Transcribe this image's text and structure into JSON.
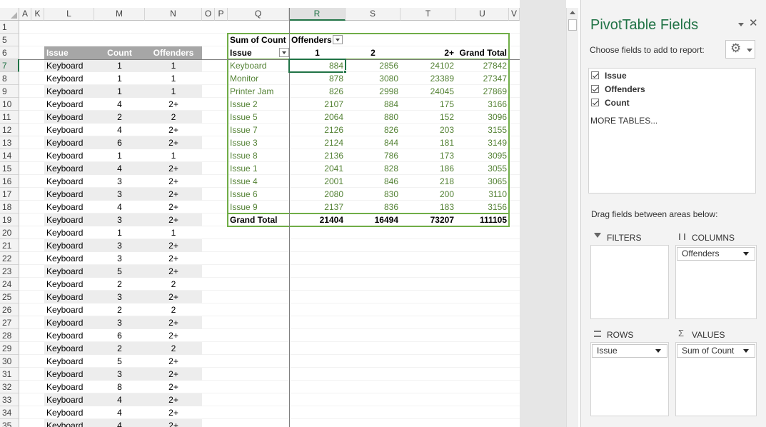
{
  "columns": [
    {
      "label": "A",
      "width": 17
    },
    {
      "label": "K",
      "width": 18
    },
    {
      "label": "L",
      "width": 70
    },
    {
      "label": "M",
      "width": 71
    },
    {
      "label": "N",
      "width": 80
    },
    {
      "label": "O",
      "width": 18
    },
    {
      "label": "P",
      "width": 18
    },
    {
      "label": "Q",
      "width": 86
    },
    {
      "label": "R",
      "width": 79
    },
    {
      "label": "S",
      "width": 77
    },
    {
      "label": "T",
      "width": 78
    },
    {
      "label": "U",
      "width": 74
    },
    {
      "label": "V",
      "width": 15
    }
  ],
  "selected_column": "R",
  "selected_row": "7",
  "row_numbers": [
    "1",
    "5",
    "6",
    "7",
    "8",
    "9",
    "10",
    "11",
    "12",
    "13",
    "14",
    "15",
    "16",
    "17",
    "18",
    "19",
    "20",
    "21",
    "22",
    "23",
    "24",
    "25",
    "26",
    "27",
    "28",
    "29",
    "30",
    "31",
    "32",
    "33",
    "34",
    "35"
  ],
  "table": {
    "headers": [
      "Issue",
      "Count",
      "Offenders"
    ],
    "rows": [
      [
        "Keyboard",
        "1",
        "1"
      ],
      [
        "Keyboard",
        "1",
        "1"
      ],
      [
        "Keyboard",
        "1",
        "1"
      ],
      [
        "Keyboard",
        "4",
        "2+"
      ],
      [
        "Keyboard",
        "2",
        "2"
      ],
      [
        "Keyboard",
        "4",
        "2+"
      ],
      [
        "Keyboard",
        "6",
        "2+"
      ],
      [
        "Keyboard",
        "1",
        "1"
      ],
      [
        "Keyboard",
        "4",
        "2+"
      ],
      [
        "Keyboard",
        "3",
        "2+"
      ],
      [
        "Keyboard",
        "3",
        "2+"
      ],
      [
        "Keyboard",
        "4",
        "2+"
      ],
      [
        "Keyboard",
        "3",
        "2+"
      ],
      [
        "Keyboard",
        "1",
        "1"
      ],
      [
        "Keyboard",
        "3",
        "2+"
      ],
      [
        "Keyboard",
        "3",
        "2+"
      ],
      [
        "Keyboard",
        "5",
        "2+"
      ],
      [
        "Keyboard",
        "2",
        "2"
      ],
      [
        "Keyboard",
        "3",
        "2+"
      ],
      [
        "Keyboard",
        "2",
        "2"
      ],
      [
        "Keyboard",
        "3",
        "2+"
      ],
      [
        "Keyboard",
        "6",
        "2+"
      ],
      [
        "Keyboard",
        "2",
        "2"
      ],
      [
        "Keyboard",
        "5",
        "2+"
      ],
      [
        "Keyboard",
        "3",
        "2+"
      ],
      [
        "Keyboard",
        "8",
        "2+"
      ],
      [
        "Keyboard",
        "4",
        "2+"
      ],
      [
        "Keyboard",
        "4",
        "2+"
      ],
      [
        "Keyboard",
        "4",
        "2+"
      ]
    ]
  },
  "pivot": {
    "value_label": "Sum of Count",
    "column_field": "Offenders",
    "row_field": "Issue",
    "col_headers": [
      "1",
      "2",
      "2+",
      "Grand Total"
    ],
    "rows": [
      {
        "label": "Keyboard",
        "values": [
          "884",
          "2856",
          "24102",
          "27842"
        ]
      },
      {
        "label": "Monitor",
        "values": [
          "878",
          "3080",
          "23389",
          "27347"
        ]
      },
      {
        "label": "Printer Jam",
        "values": [
          "826",
          "2998",
          "24045",
          "27869"
        ]
      },
      {
        "label": "Issue 2",
        "values": [
          "2107",
          "884",
          "175",
          "3166"
        ]
      },
      {
        "label": "Issue 5",
        "values": [
          "2064",
          "880",
          "152",
          "3096"
        ]
      },
      {
        "label": "Issue 7",
        "values": [
          "2126",
          "826",
          "203",
          "3155"
        ]
      },
      {
        "label": "Issue 3",
        "values": [
          "2124",
          "844",
          "181",
          "3149"
        ]
      },
      {
        "label": "Issue 8",
        "values": [
          "2136",
          "786",
          "173",
          "3095"
        ]
      },
      {
        "label": "Issue 1",
        "values": [
          "2041",
          "828",
          "186",
          "3055"
        ]
      },
      {
        "label": "Issue 4",
        "values": [
          "2001",
          "846",
          "218",
          "3065"
        ]
      },
      {
        "label": "Issue 6",
        "values": [
          "2080",
          "830",
          "200",
          "3110"
        ]
      },
      {
        "label": "Issue 9",
        "values": [
          "2137",
          "836",
          "183",
          "3156"
        ]
      }
    ],
    "total": {
      "label": "Grand Total",
      "values": [
        "21404",
        "16494",
        "73207",
        "111105"
      ]
    }
  },
  "panel": {
    "title": "PivotTable Fields",
    "choose_label": "Choose fields to add to report:",
    "fields": [
      "Issue",
      "Offenders",
      "Count"
    ],
    "more_tables": "MORE TABLES...",
    "drag_label": "Drag fields between areas below:",
    "filters_label": "FILTERS",
    "columns_label": "COLUMNS",
    "rows_label": "ROWS",
    "values_label": "VALUES",
    "columns_chip": "Offenders",
    "rows_chip": "Issue",
    "values_chip": "Sum of Count",
    "close_glyph": "✕",
    "gear_glyph": "⚙",
    "icons": {
      "filters": "filter-icon",
      "columns": "columns-icon",
      "rows": "rows-icon",
      "values": "sigma-icon"
    },
    "accent": "#217346"
  }
}
